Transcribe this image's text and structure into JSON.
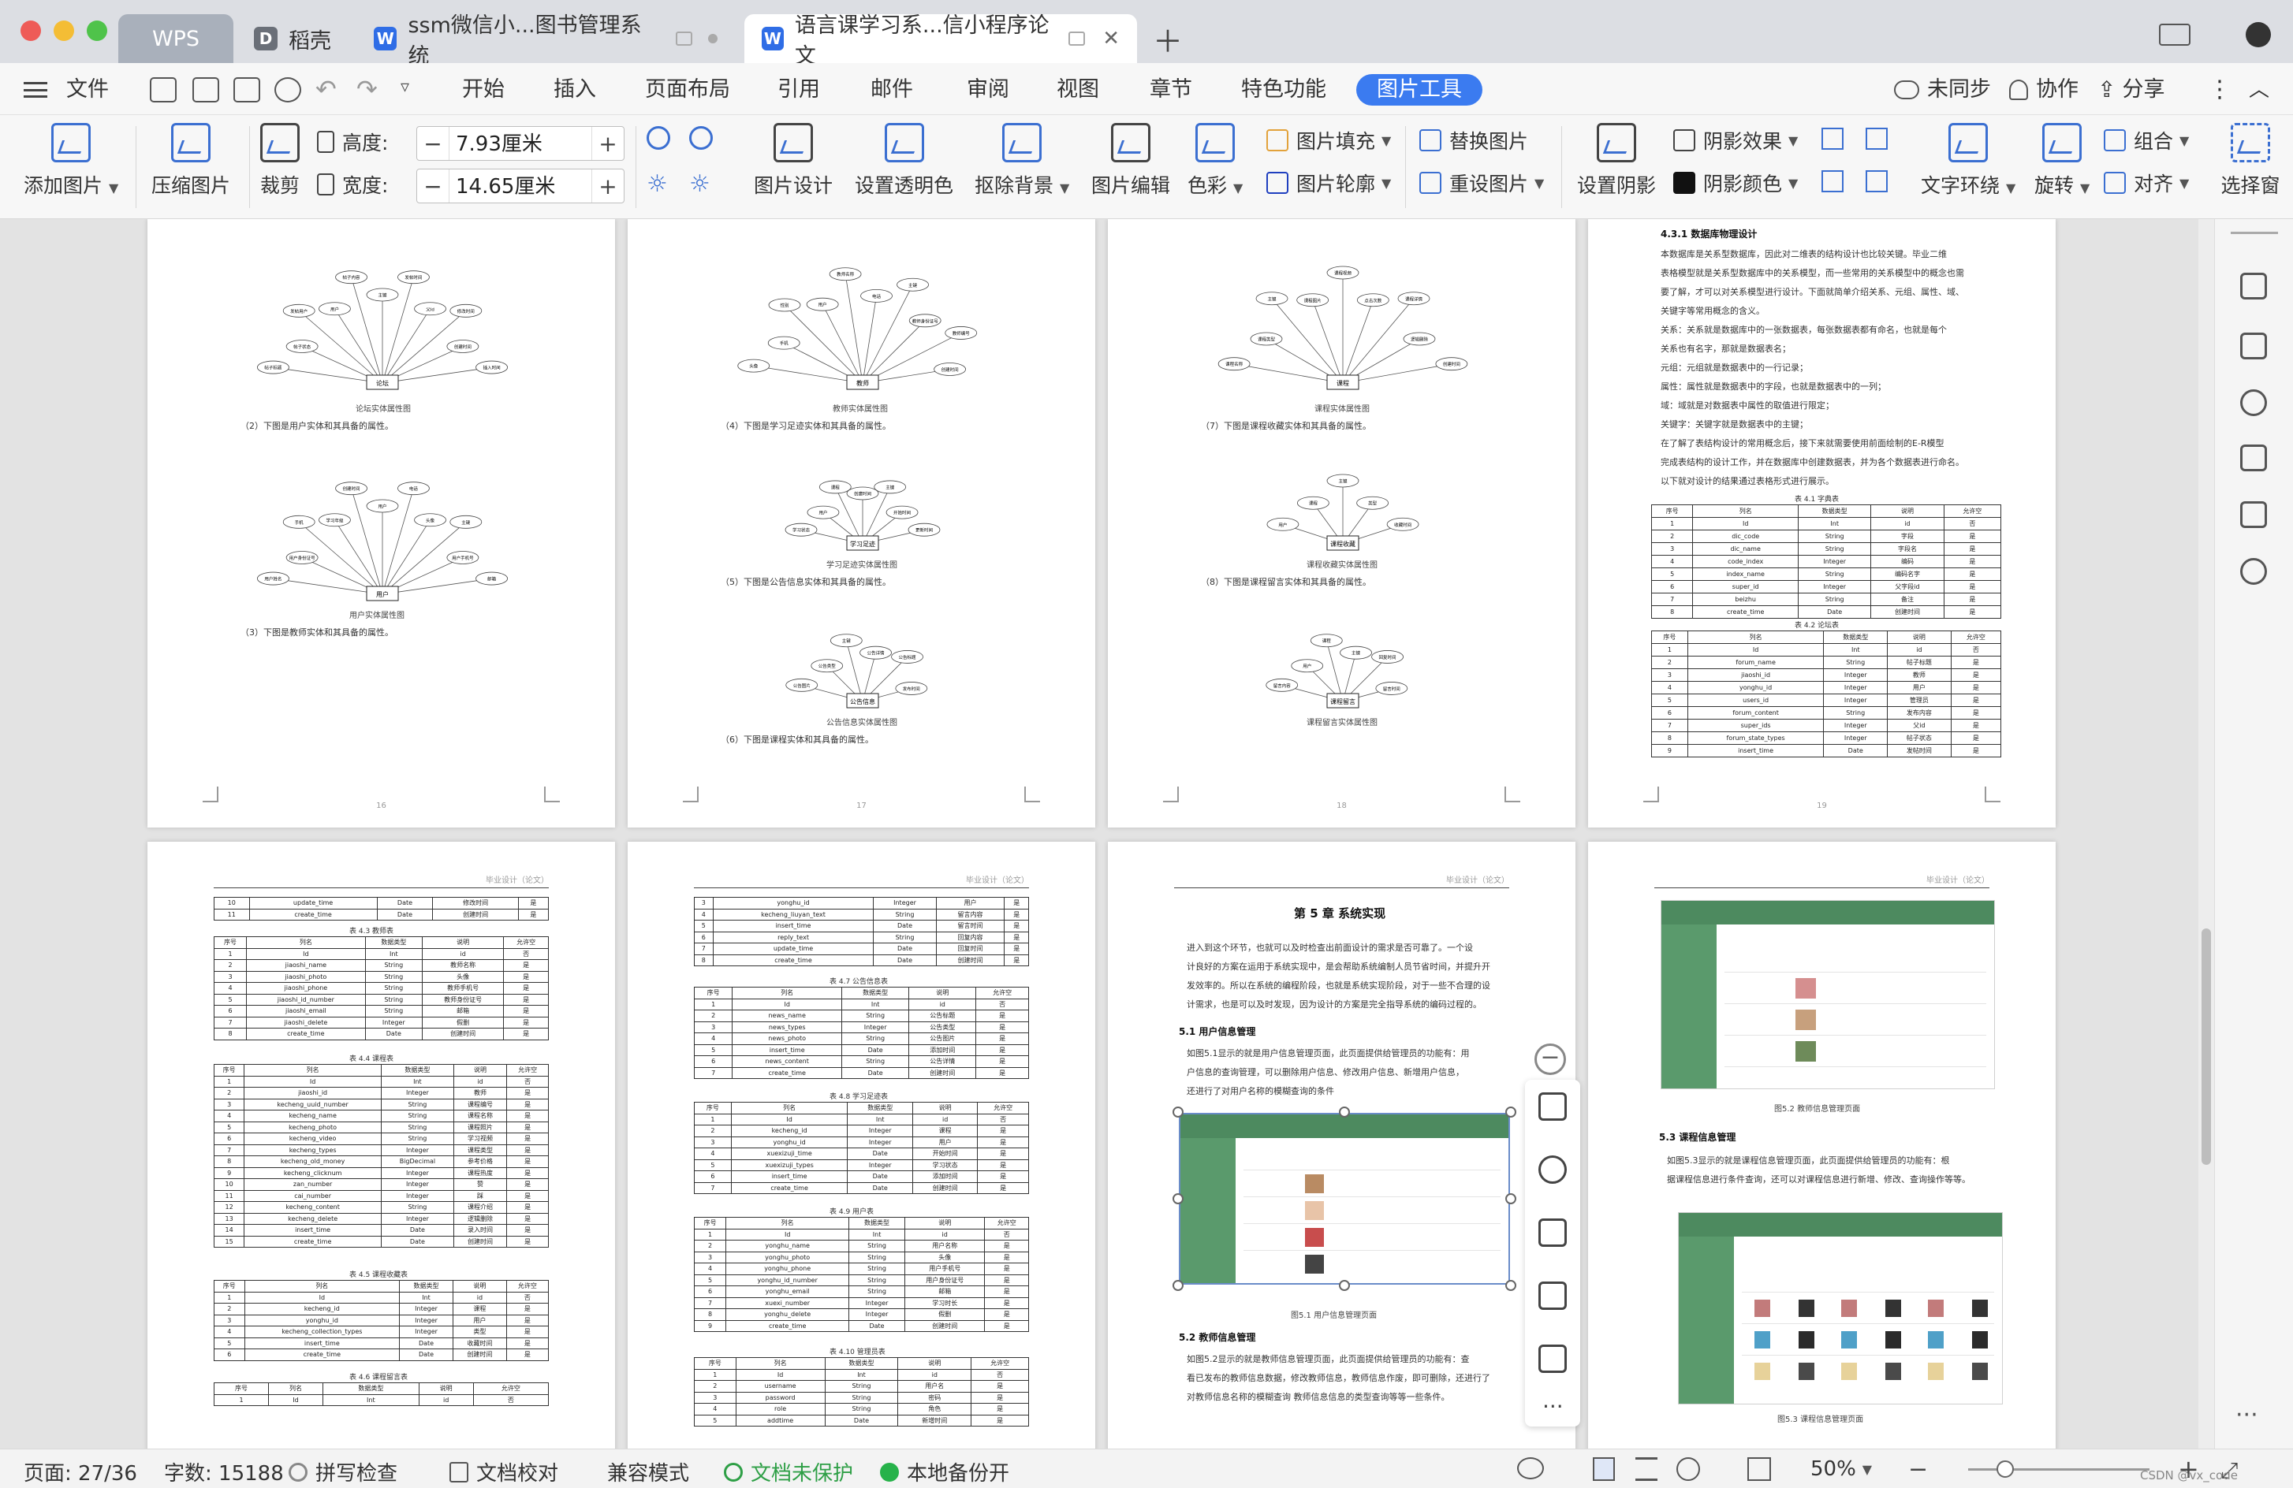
{
  "tabs": [
    {
      "label": "WPS"
    },
    {
      "label": "稻壳"
    },
    {
      "label": "ssm微信小...图书管理系统"
    },
    {
      "label": "语言课学习系...信小程序论文"
    }
  ],
  "menu": [
    "文件",
    "开始",
    "插入",
    "页面布局",
    "引用",
    "邮件",
    "审阅",
    "视图",
    "章节",
    "特色功能",
    "图片工具"
  ],
  "menu_right": {
    "sync": "未同步",
    "collab": "协作",
    "share": "分享"
  },
  "ribbon": {
    "add_image": "添加图片",
    "compress": "压缩图片",
    "crop": "裁剪",
    "height_label": "高度:",
    "height_value": "7.93厘米",
    "width_label": "宽度:",
    "width_value": "14.65厘米",
    "image_design": "图片设计",
    "set_transparent": "设置透明色",
    "cutout": "抠除背景",
    "image_edit": "图片编辑",
    "color": "色彩",
    "image_fill": "图片填充",
    "image_outline": "图片轮廓",
    "replace_image": "替换图片",
    "reset_image": "重设图片",
    "set_shadow": "设置阴影",
    "shadow_effect": "阴影效果",
    "shadow_color": "阴影颜色",
    "text_wrap": "文字环绕",
    "rotate": "旋转",
    "group": "组合",
    "align": "对齐",
    "select_pane": "选择窗"
  },
  "pages_top": [
    {
      "num": "16",
      "diagrams": [
        {
          "center": "论坛",
          "caption": "论坛实体属性图",
          "attrs": [
            "帖子标题",
            "帖子状态",
            "发帖用户",
            "用户",
            "帖子内容",
            "主键",
            "发帖时间",
            "父Id",
            "修改时间",
            "创建时间",
            "插入时间"
          ]
        },
        {
          "center": "用户",
          "caption": "用户实体属性图",
          "attrs": [
            "用户姓名",
            "用户身份证号",
            "手机",
            "学习年级",
            "创建时间",
            "用户",
            "电话",
            "头像",
            "主键",
            "用户手机号",
            "邮箱"
          ]
        }
      ],
      "texts": [
        "（2）下图是用户实体和其具备的属性。",
        "（3）下图是教师实体和其具备的属性。"
      ]
    },
    {
      "num": "17",
      "diagrams": [
        {
          "center": "教师",
          "caption": "教师实体属性图",
          "attrs": [
            "头像",
            "手机",
            "性别",
            "用户",
            "教师名称",
            "电话",
            "主键",
            "教师身份证号",
            "教师编号",
            "创建时间"
          ]
        },
        {
          "center": "学习足迹",
          "caption": "学习足迹实体属性图",
          "attrs": [
            "学习状态",
            "用户",
            "课程",
            "创建时间",
            "主键",
            "开始时间",
            "更新时间"
          ]
        },
        {
          "center": "公告信息",
          "caption": "公告信息实体属性图",
          "attrs": [
            "公告图片",
            "公告类型",
            "主键",
            "公告详情",
            "公告标题",
            "发布时间"
          ]
        }
      ],
      "texts": [
        "（4）下图是学习足迹实体和其具备的属性。",
        "（5）下图是公告信息实体和其具备的属性。",
        "（6）下图是课程实体和其具备的属性。"
      ]
    },
    {
      "num": "18",
      "diagrams": [
        {
          "center": "课程",
          "caption": "课程实体属性图",
          "attrs": [
            "课程名称",
            "课程类型",
            "主键",
            "课程图片",
            "课程视频",
            "点击次数",
            "课程详情",
            "逻辑删除",
            "创建时间"
          ]
        },
        {
          "center": "课程收藏",
          "caption": "课程收藏实体属性图",
          "attrs": [
            "用户",
            "课程",
            "主键",
            "类型",
            "收藏时间"
          ]
        },
        {
          "center": "课程留言",
          "caption": "课程留言实体属性图",
          "attrs": [
            "留言内容",
            "用户",
            "课程",
            "主键",
            "回复时间",
            "留言时间"
          ]
        }
      ],
      "texts": [
        "（7）下图是课程收藏实体和其具备的属性。",
        "（8）下图是课程留言实体和其具备的属性。"
      ]
    },
    {
      "num": "19",
      "heading": "4.3.1 数据库物理设计",
      "paragraphs": [
        "本数据库是关系型数据库，因此对二维表的结构设计也比较关键。毕业二维",
        "表格模型就是关系型数据库中的关系模型，而一些常用的关系模型中的概念也需",
        "要了解，才可以对关系模型进行设计。下面就简单介绍关系、元组、属性、域、",
        "关键字等常用概念的含义。",
        "关系：关系就是数据库中的一张数据表，每张数据表都有命名，也就是每个",
        "关系也有名字，那就是数据表名；",
        "元组：元组就是数据表中的一行记录；",
        "属性：属性就是数据表中的字段，也就是数据表中的一列；",
        "域：域就是对数据表中属性的取值进行限定；",
        "关键字：关键字就是数据表中的主键；",
        "在了解了表结构设计的常用概念后，接下来就需要使用前面绘制的E-R模型",
        "完成表结构的设计工作，并在数据库中创建数据表，并为各个数据表进行命名。",
        "以下就对设计的结果通过表格形式进行展示。"
      ],
      "table1": {
        "caption": "表 4.1 字典表",
        "header": [
          "序号",
          "列名",
          "数据类型",
          "说明",
          "允许空"
        ],
        "rows": [
          [
            "1",
            "Id",
            "Int",
            "id",
            "否"
          ],
          [
            "2",
            "dic_code",
            "String",
            "字段",
            "是"
          ],
          [
            "3",
            "dic_name",
            "String",
            "字段名",
            "是"
          ],
          [
            "4",
            "code_index",
            "Integer",
            "编码",
            "是"
          ],
          [
            "5",
            "index_name",
            "String",
            "编码名字",
            "是"
          ],
          [
            "6",
            "super_id",
            "Integer",
            "父字段id",
            "是"
          ],
          [
            "7",
            "beizhu",
            "String",
            "备注",
            "是"
          ],
          [
            "8",
            "create_time",
            "Date",
            "创建时间",
            "是"
          ]
        ]
      },
      "table2": {
        "caption": "表 4.2 论坛表",
        "header": [
          "序号",
          "列名",
          "数据类型",
          "说明",
          "允许空"
        ],
        "rows": [
          [
            "1",
            "Id",
            "Int",
            "id",
            "否"
          ],
          [
            "2",
            "forum_name",
            "String",
            "帖子标题",
            "是"
          ],
          [
            "3",
            "jiaoshi_id",
            "Integer",
            "教师",
            "是"
          ],
          [
            "4",
            "yonghu_id",
            "Integer",
            "用户",
            "是"
          ],
          [
            "5",
            "users_id",
            "Integer",
            "管理员",
            "是"
          ],
          [
            "6",
            "forum_content",
            "String",
            "发布内容",
            "是"
          ],
          [
            "7",
            "super_ids",
            "Integer",
            "父id",
            "是"
          ],
          [
            "8",
            "forum_state_types",
            "Integer",
            "帖子状态",
            "是"
          ],
          [
            "9",
            "insert_time",
            "Date",
            "发帖时间",
            "是"
          ]
        ]
      }
    }
  ],
  "pages_bottom": [
    {
      "header": "毕业设计（论文）",
      "blocks": [
        {
          "caption": "",
          "rows": [
            [
              "10",
              "update_time",
              "Date",
              "修改时间",
              "是"
            ],
            [
              "11",
              "create_time",
              "Date",
              "创建时间",
              "是"
            ]
          ]
        },
        {
          "caption": "表 4.3 教师表",
          "rows": [
            [
              "序号",
              "列名",
              "数据类型",
              "说明",
              "允许空"
            ],
            [
              "1",
              "Id",
              "Int",
              "id",
              "否"
            ],
            [
              "2",
              "jiaoshi_name",
              "String",
              "教师名称",
              "是"
            ],
            [
              "3",
              "jiaoshi_photo",
              "String",
              "头像",
              "是"
            ],
            [
              "4",
              "jiaoshi_phone",
              "String",
              "教师手机号",
              "是"
            ],
            [
              "5",
              "jiaoshi_id_number",
              "String",
              "教师身份证号",
              "是"
            ],
            [
              "6",
              "jiaoshi_email",
              "String",
              "邮箱",
              "是"
            ],
            [
              "7",
              "jiaoshi_delete",
              "Integer",
              "假删",
              "是"
            ],
            [
              "8",
              "create_time",
              "Date",
              "创建时间",
              "是"
            ]
          ]
        },
        {
          "caption": "表 4.4 课程表",
          "rows": [
            [
              "序号",
              "列名",
              "数据类型",
              "说明",
              "允许空"
            ],
            [
              "1",
              "Id",
              "Int",
              "id",
              "否"
            ],
            [
              "2",
              "jiaoshi_id",
              "Integer",
              "教师",
              "是"
            ],
            [
              "3",
              "kecheng_uuid_number",
              "String",
              "课程编号",
              "是"
            ],
            [
              "4",
              "kecheng_name",
              "String",
              "课程名称",
              "是"
            ],
            [
              "5",
              "kecheng_photo",
              "String",
              "课程照片",
              "是"
            ],
            [
              "6",
              "kecheng_video",
              "String",
              "学习视频",
              "是"
            ],
            [
              "7",
              "kecheng_types",
              "Integer",
              "课程类型",
              "是"
            ],
            [
              "8",
              "kecheng_old_money",
              "BigDecimal",
              "参考价格",
              "是"
            ],
            [
              "9",
              "kecheng_clicknum",
              "Integer",
              "课程热度",
              "是"
            ],
            [
              "10",
              "zan_number",
              "Integer",
              "赞",
              "是"
            ],
            [
              "11",
              "cai_number",
              "Integer",
              "踩",
              "是"
            ],
            [
              "12",
              "kecheng_content",
              "String",
              "课程介绍",
              "是"
            ],
            [
              "13",
              "kecheng_delete",
              "Integer",
              "逻辑删除",
              "是"
            ],
            [
              "14",
              "insert_time",
              "Date",
              "录入时间",
              "是"
            ],
            [
              "15",
              "create_time",
              "Date",
              "创建时间",
              "是"
            ]
          ]
        },
        {
          "caption": "表 4.5 课程收藏表",
          "rows": [
            [
              "序号",
              "列名",
              "数据类型",
              "说明",
              "允许空"
            ],
            [
              "1",
              "Id",
              "Int",
              "id",
              "否"
            ],
            [
              "2",
              "kecheng_id",
              "Integer",
              "课程",
              "是"
            ],
            [
              "3",
              "yonghu_id",
              "Integer",
              "用户",
              "是"
            ],
            [
              "4",
              "kecheng_collection_types",
              "Integer",
              "类型",
              "是"
            ],
            [
              "5",
              "insert_time",
              "Date",
              "收藏时间",
              "是"
            ],
            [
              "6",
              "create_time",
              "Date",
              "创建时间",
              "是"
            ]
          ]
        },
        {
          "caption": "表 4.6 课程留言表",
          "rows": [
            [
              "序号",
              "列名",
              "数据类型",
              "说明",
              "允许空"
            ],
            [
              "1",
              "Id",
              "Int",
              "id",
              "否"
            ]
          ]
        }
      ]
    },
    {
      "header": "毕业设计（论文）",
      "blocks": [
        {
          "caption": "",
          "rows": [
            [
              "3",
              "yonghu_id",
              "Integer",
              "用户",
              "是"
            ],
            [
              "4",
              "kecheng_liuyan_text",
              "String",
              "留言内容",
              "是"
            ],
            [
              "5",
              "insert_time",
              "Date",
              "留言时间",
              "是"
            ],
            [
              "6",
              "reply_text",
              "String",
              "回复内容",
              "是"
            ],
            [
              "7",
              "update_time",
              "Date",
              "回复时间",
              "是"
            ],
            [
              "8",
              "create_time",
              "Date",
              "创建时间",
              "是"
            ]
          ]
        },
        {
          "caption": "表 4.7 公告信息表",
          "rows": [
            [
              "序号",
              "列名",
              "数据类型",
              "说明",
              "允许空"
            ],
            [
              "1",
              "Id",
              "Int",
              "id",
              "否"
            ],
            [
              "2",
              "news_name",
              "String",
              "公告标题",
              "是"
            ],
            [
              "3",
              "news_types",
              "Integer",
              "公告类型",
              "是"
            ],
            [
              "4",
              "news_photo",
              "String",
              "公告图片",
              "是"
            ],
            [
              "5",
              "insert_time",
              "Date",
              "添加时间",
              "是"
            ],
            [
              "6",
              "news_content",
              "String",
              "公告详情",
              "是"
            ],
            [
              "7",
              "create_time",
              "Date",
              "创建时间",
              "是"
            ]
          ]
        },
        {
          "caption": "表 4.8 学习足迹表",
          "rows": [
            [
              "序号",
              "列名",
              "数据类型",
              "说明",
              "允许空"
            ],
            [
              "1",
              "Id",
              "Int",
              "id",
              "否"
            ],
            [
              "2",
              "kecheng_id",
              "Integer",
              "课程",
              "是"
            ],
            [
              "3",
              "yonghu_id",
              "Integer",
              "用户",
              "是"
            ],
            [
              "4",
              "xuexizuji_time",
              "Date",
              "开始时间",
              "是"
            ],
            [
              "5",
              "xuexizuji_types",
              "Integer",
              "学习状态",
              "是"
            ],
            [
              "6",
              "insert_time",
              "Date",
              "添加时间",
              "是"
            ],
            [
              "7",
              "create_time",
              "Date",
              "创建时间",
              "是"
            ]
          ]
        },
        {
          "caption": "表 4.9 用户表",
          "rows": [
            [
              "序号",
              "列名",
              "数据类型",
              "说明",
              "允许空"
            ],
            [
              "1",
              "Id",
              "Int",
              "id",
              "否"
            ],
            [
              "2",
              "yonghu_name",
              "String",
              "用户名称",
              "是"
            ],
            [
              "3",
              "yonghu_photo",
              "String",
              "头像",
              "是"
            ],
            [
              "4",
              "yonghu_phone",
              "String",
              "用户手机号",
              "是"
            ],
            [
              "5",
              "yonghu_id_number",
              "String",
              "用户身份证号",
              "是"
            ],
            [
              "6",
              "yonghu_email",
              "String",
              "邮箱",
              "是"
            ],
            [
              "7",
              "xuexi_number",
              "Integer",
              "学习时长",
              "是"
            ],
            [
              "8",
              "yonghu_delete",
              "Integer",
              "假删",
              "是"
            ],
            [
              "9",
              "create_time",
              "Date",
              "创建时间",
              "是"
            ]
          ]
        },
        {
          "caption": "表 4.10 管理员表",
          "rows": [
            [
              "序号",
              "列名",
              "数据类型",
              "说明",
              "允许空"
            ],
            [
              "1",
              "Id",
              "Int",
              "id",
              "否"
            ],
            [
              "2",
              "username",
              "String",
              "用户名",
              "是"
            ],
            [
              "3",
              "password",
              "String",
              "密码",
              "是"
            ],
            [
              "4",
              "role",
              "String",
              "角色",
              "是"
            ],
            [
              "5",
              "addtime",
              "Date",
              "新增时间",
              "是"
            ]
          ]
        }
      ]
    },
    {
      "header": "毕业设计（论文）",
      "chapter": "第 5 章  系统实现",
      "intro": [
        "进入到这个环节，也就可以及时检查出前面设计的需求是否可靠了。一个设",
        "计良好的方案在运用于系统实现中，是会帮助系统编制人员节省时间，并提升开",
        "发效率的。所以在系统的编程阶段，也就是系统实现阶段，对于一些不合理的设",
        "计需求，也是可以及时发现，因为设计的方案是完全指导系统的编码过程的。"
      ],
      "s51": "5.1 用户信息管理",
      "s51_text": [
        "如图5.1显示的就是用户信息管理页面，此页面提供给管理员的功能有：用",
        "户信息的查询管理，可以删除用户信息、修改用户信息、新增用户信息，",
        "还进行了对用户名称的模糊查询的条件"
      ],
      "fig51": "图5.1 用户信息管理页面",
      "s52": "5.2 教师信息管理",
      "s52_text": [
        "如图5.2显示的就是教师信息管理页面，此页面提供给管理员的功能有：查",
        "看已发布的教师信息数据，修改教师信息，教师信息作废，即可删除，还进行了",
        "对教师信息名称的模糊查询 教师信息信息的类型查询等等一些条件。"
      ]
    },
    {
      "header": "毕业设计（论文）",
      "fig52": "图5.2 教师信息管理页面",
      "s53": "5.3 课程信息管理",
      "s53_text": [
        "如图5.3显示的就是课程信息管理页面，此页面提供给管理员的功能有：根",
        "据课程信息进行条件查询，还可以对课程信息进行新增、修改、查询操作等等。"
      ],
      "fig53": "图5.3 课程信息管理页面"
    }
  ],
  "status": {
    "page": "页面: 27/36",
    "words": "字数: 15188",
    "spell": "拼写检查",
    "proof": "文档校对",
    "compat": "兼容模式",
    "unprotected": "文档未保护",
    "backup": "本地备份开",
    "zoom": "50%",
    "watermark": "CSDN @vx_code"
  }
}
